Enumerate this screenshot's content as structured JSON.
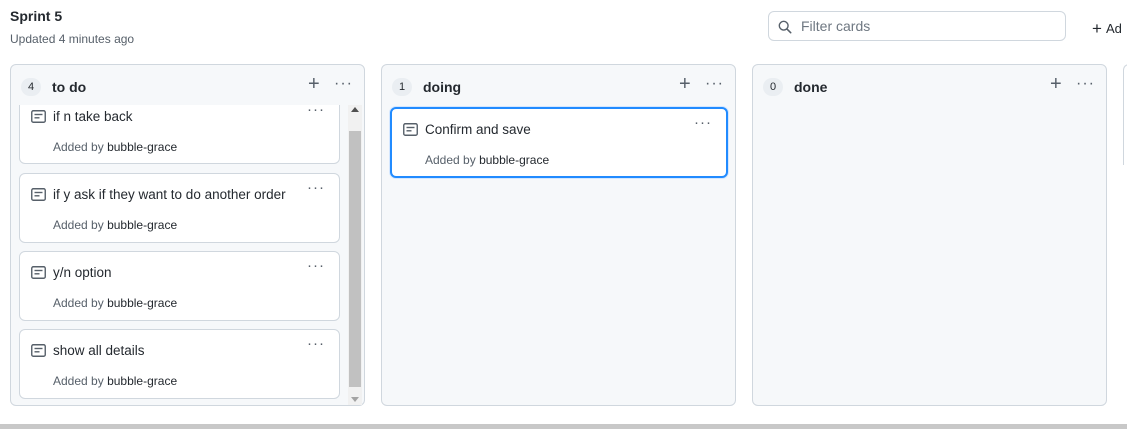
{
  "board": {
    "title": "Sprint 5",
    "updated": "Updated 4 minutes ago",
    "filter_placeholder": "Filter cards",
    "add_column_label": "Ad"
  },
  "columns": [
    {
      "count": "4",
      "name": "to do",
      "cards": [
        {
          "title": "if n take back",
          "added_by_prefix": "Added by",
          "author": "bubble-grace"
        },
        {
          "title": "if y ask if they want to do another order",
          "added_by_prefix": "Added by",
          "author": "bubble-grace"
        },
        {
          "title": "y/n option",
          "added_by_prefix": "Added by",
          "author": "bubble-grace"
        },
        {
          "title": "show all details",
          "added_by_prefix": "Added by",
          "author": "bubble-grace"
        }
      ]
    },
    {
      "count": "1",
      "name": "doing",
      "cards": [
        {
          "title": "Confirm and save",
          "added_by_prefix": "Added by",
          "author": "bubble-grace"
        }
      ]
    },
    {
      "count": "0",
      "name": "done",
      "cards": []
    }
  ],
  "icons": {
    "search": "search-icon",
    "plus": "plus-icon",
    "more": "more-icon",
    "note": "note-icon"
  },
  "colors": {
    "accent": "#218bff",
    "column_bg": "#f6f8fa",
    "border": "#d0d7de"
  }
}
